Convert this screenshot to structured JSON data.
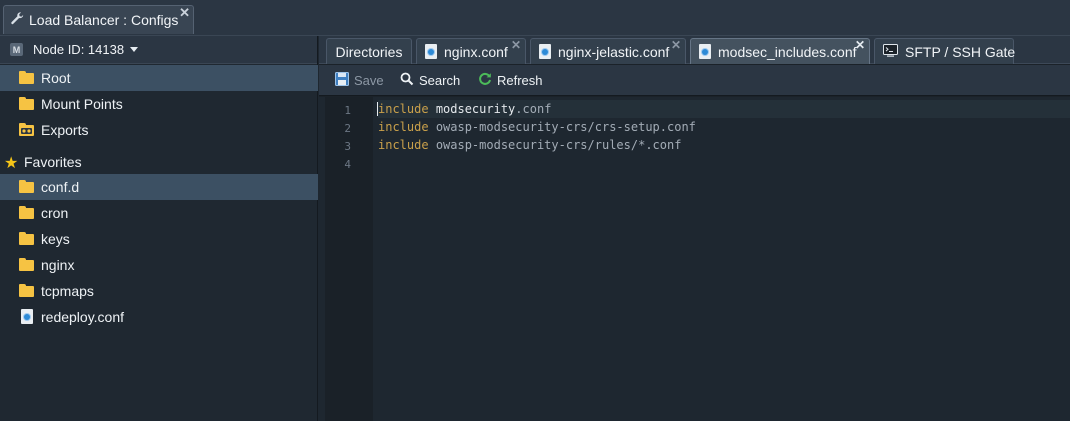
{
  "window_tab": {
    "title": "Load Balancer : Configs",
    "icon": "wrench-icon"
  },
  "node": {
    "label": "Node ID: 14138",
    "badge": "M"
  },
  "tree": {
    "items": [
      {
        "label": "Root",
        "icon": "folder-icon",
        "selected": true
      },
      {
        "label": "Mount Points",
        "icon": "folder-icon"
      },
      {
        "label": "Exports",
        "icon": "exports-icon"
      }
    ],
    "favorites_label": "Favorites",
    "favorites": [
      {
        "label": "conf.d",
        "icon": "folder-icon",
        "selected": true
      },
      {
        "label": "cron",
        "icon": "folder-icon"
      },
      {
        "label": "keys",
        "icon": "folder-icon"
      },
      {
        "label": "nginx",
        "icon": "folder-icon"
      },
      {
        "label": "tcpmaps",
        "icon": "folder-icon"
      },
      {
        "label": "redeploy.conf",
        "icon": "config-file-icon"
      }
    ]
  },
  "file_tabs": [
    {
      "label": "Directories"
    },
    {
      "label": "nginx.conf",
      "icon": "config-file-icon",
      "closable": true
    },
    {
      "label": "nginx-jelastic.conf",
      "icon": "config-file-icon",
      "closable": true
    },
    {
      "label": "modsec_includes.conf",
      "icon": "config-file-icon",
      "closable": true,
      "active": true
    },
    {
      "label": "SFTP / SSH Gate",
      "icon": "terminal-icon"
    }
  ],
  "toolbar": {
    "save": "Save",
    "search": "Search",
    "refresh": "Refresh"
  },
  "editor": {
    "line_numbers": [
      "1",
      "2",
      "3",
      "4"
    ],
    "lines": [
      {
        "kw": "include",
        "a": "modsecurity",
        "b": ".conf"
      },
      {
        "kw": "include",
        "a": "",
        "b": "owasp-modsecurity-crs/crs-setup.conf"
      },
      {
        "kw": "include",
        "a": "",
        "b": "owasp-modsecurity-crs/rules/*.conf"
      }
    ]
  },
  "colors": {
    "accent_folder": "#f6c343",
    "favorite_star": "#f5c518",
    "refresh_green": "#4cbb5a",
    "keyword": "#c9a04b"
  }
}
